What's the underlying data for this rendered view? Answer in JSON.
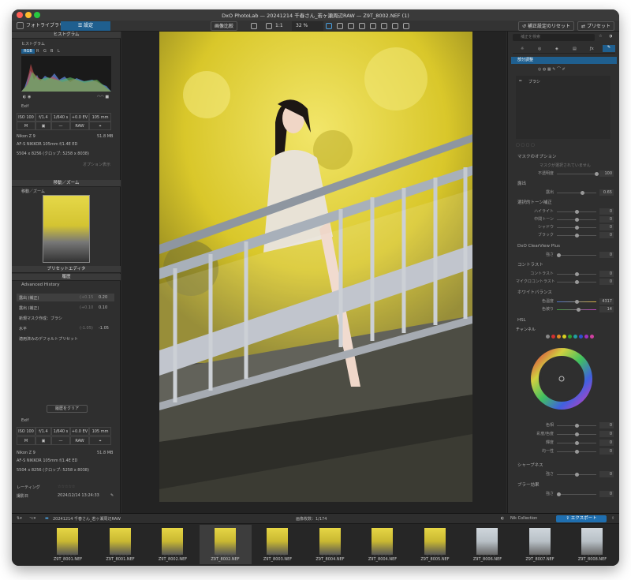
{
  "window": {
    "title": "DxO PhotoLab — 20241214 千春さん_若ヶ瀬周辺RAW — Z9T_8002.NEF (1)"
  },
  "toolbar": {
    "tab_library": "フォトライブラリ",
    "tab_customize": "設定",
    "compare": "画像比較",
    "zoom_one": "1:1",
    "zoom_pct": "32 %",
    "reset": "補正設定のリセット",
    "presets": "プリセット"
  },
  "left": {
    "histogram_header": "ヒストグラム",
    "histogram_label": "ヒストグラム",
    "channels": [
      "RGB",
      "R",
      "G",
      "B",
      "L"
    ],
    "exif_label": "Exif",
    "exif_cells": [
      "ISO 100",
      "f/1.4",
      "1/640 s",
      "+0.0 EV",
      "105 mm"
    ],
    "exif_cells2": [
      "M",
      "",
      "—",
      "RAW",
      ""
    ],
    "camera": "Nikon Z 9",
    "filesize": "51.8 MB",
    "lens": "AF-S NIKKOR 105mm f/1.4E ED",
    "dims": "5504 x 8256 (クロップ: 5258 x 8038)",
    "options": "オプション表示",
    "nav_header": "移動／ズーム",
    "nav_label": "移動／ズーム",
    "preset_header": "プリセットエディタ",
    "history_header": "履歴",
    "history_label": "Advanced History",
    "history": [
      {
        "name": "露出 (補正)",
        "from": "(+0.15",
        "to": "0.20"
      },
      {
        "name": "露出 (補正)",
        "from": "(+0.10",
        "to": "0.10"
      },
      {
        "name": "新規マスク作成：ブラシ",
        "from": "",
        "to": ""
      },
      {
        "name": "水平",
        "from": "(-1.05)",
        "to": "-1.05"
      },
      {
        "name": "適用済みのデフォルトプリセット",
        "from": "",
        "to": ""
      }
    ],
    "clear_history": "履歴をクリア",
    "exif2_label": "Exif",
    "rating_label": "レーティング",
    "date_label": "撮影日",
    "date": "2024/12/14 13:24:33"
  },
  "right": {
    "search_placeholder": "補正を検索",
    "local_adjust": "部分調整",
    "brush": "ブラシ",
    "mask_options": "マスクのオプション",
    "mask_none": "マスクが選択されていません",
    "opacity_label": "不透明度",
    "opacity_val": "100",
    "exposure_section": "露出",
    "exposure_label": "露出",
    "exposure_val": "0.65",
    "tone_section": "選択的トーン補正",
    "tone": [
      {
        "label": "ハイライト",
        "val": "0"
      },
      {
        "label": "中間トーン",
        "val": "0"
      },
      {
        "label": "シャドウ",
        "val": "0"
      },
      {
        "label": "ブラック",
        "val": "0"
      }
    ],
    "clearview_section": "DxO ClearView Plus",
    "clearview_label": "強さ",
    "clearview_val": "0",
    "contrast_section": "コントラスト",
    "contrast": [
      {
        "label": "コントラスト",
        "val": "0"
      },
      {
        "label": "マイクロコントラスト",
        "val": "0"
      }
    ],
    "wb_section": "ホワイトバランス",
    "wb": [
      {
        "label": "色温度",
        "val": "4317"
      },
      {
        "label": "色被り",
        "val": "14"
      }
    ],
    "hsl_section": "HSL",
    "hsl_channel": "チャンネル",
    "hsl_colors": [
      "#888888",
      "#d03030",
      "#e08a20",
      "#d8d020",
      "#30a030",
      "#20a0a0",
      "#3050d0",
      "#a030c0",
      "#d040a0"
    ],
    "hsl_rows": [
      {
        "label": "色相",
        "val": "0"
      },
      {
        "label": "彩度/色度",
        "val": "0"
      },
      {
        "label": "輝度",
        "val": "0"
      },
      {
        "label": "均一性",
        "val": "0"
      }
    ],
    "sharpen_section": "シャープネス",
    "sharpen_label": "強さ",
    "sharpen_val": "0",
    "blur_section": "ブラー効果",
    "blur_label": "強さ",
    "blur_val": "0"
  },
  "filmstrip": {
    "folder": "20241214 千春さん_若ヶ瀬周辺RAW",
    "count": "画像枚数：1/174",
    "nik": "Nik Collection",
    "export": "エクスポート",
    "thumbs": [
      "Z9T_8001.NEF",
      "Z9T_8001.NEF",
      "Z9T_8002.NEF",
      "Z9T_8002.NEF",
      "Z9T_8003.NEF",
      "Z9T_8004.NEF",
      "Z9T_8004.NEF",
      "Z9T_8005.NEF",
      "Z9T_8006.NEF",
      "Z9T_8007.NEF",
      "Z9T_8008.NEF"
    ]
  }
}
